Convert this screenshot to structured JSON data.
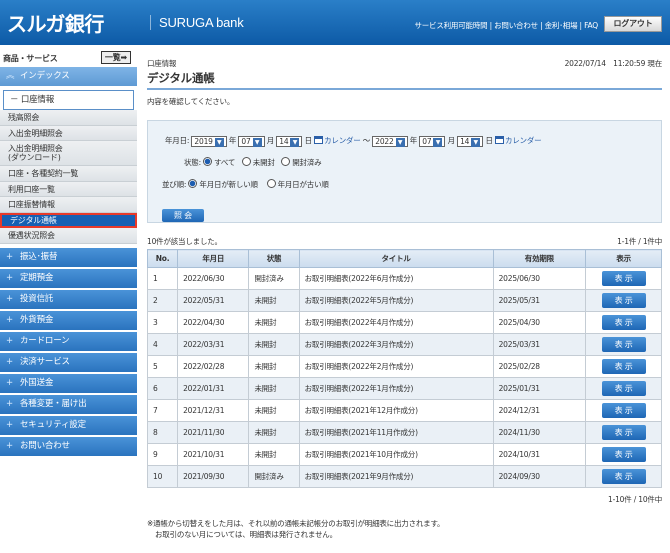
{
  "header": {
    "logo": "スルガ銀行",
    "logo_en": "SURUGA bank",
    "links": "サービス利用可能時間 | お問い合わせ | 金利･相場 | FAQ",
    "logout": "ログアウト"
  },
  "sidebar": {
    "title": "商品・サービス",
    "list_button": "一覧➡",
    "index": "インデックス",
    "account": "口座情報",
    "sub_items": [
      "残高照会",
      "入出金明細照会",
      "入出金明細照会\n(ダウンロード)",
      "口座・各種契約一覧",
      "利用口座一覧",
      "口座振替情報",
      "デジタル通帳",
      "優遇状況照会"
    ],
    "menu": [
      "振込･振替",
      "定期預金",
      "投資信託",
      "外貨預金",
      "カードローン",
      "決済サービス",
      "外国送金",
      "各種変更・届け出",
      "セキュリティ設定",
      "お問い合わせ"
    ]
  },
  "main": {
    "breadcrumb": "口座情報",
    "timestamp": "2022/07/14　11:20:59 現在",
    "title": "デジタル通帳",
    "instruction": "内容を確認してください。"
  },
  "search": {
    "date_label": "年月日:",
    "from_year": "2019",
    "from_month": "07",
    "from_day": "14",
    "to_year": "2022",
    "to_month": "07",
    "to_day": "14",
    "year_unit": "年",
    "month_unit": "月",
    "day_unit": "日",
    "calendar": "カレンダー",
    "tilde": "～",
    "status_label": "状態:",
    "status_all": "すべて",
    "status_unread": "未開封",
    "status_read": "開封済み",
    "sort_label": "並び順:",
    "sort_new": "年月日が新しい順",
    "sort_old": "年月日が古い順",
    "button": "照 会"
  },
  "results": {
    "count": "10件が該当しました。",
    "page_top": "1-1件 / 1件中",
    "page_bottom": "1-10件 / 10件中",
    "headers": [
      "No.",
      "年月日",
      "状態",
      "タイトル",
      "有効期限",
      "表示"
    ],
    "view_label": "表 示",
    "rows": [
      {
        "no": "1",
        "date": "2022/06/30",
        "status": "開封済み",
        "title": "お取引明細表(2022年6月作成分)",
        "expiry": "2025/06/30"
      },
      {
        "no": "2",
        "date": "2022/05/31",
        "status": "未開封",
        "title": "お取引明細表(2022年5月作成分)",
        "expiry": "2025/05/31"
      },
      {
        "no": "3",
        "date": "2022/04/30",
        "status": "未開封",
        "title": "お取引明細表(2022年4月作成分)",
        "expiry": "2025/04/30"
      },
      {
        "no": "4",
        "date": "2022/03/31",
        "status": "未開封",
        "title": "お取引明細表(2022年3月作成分)",
        "expiry": "2025/03/31"
      },
      {
        "no": "5",
        "date": "2022/02/28",
        "status": "未開封",
        "title": "お取引明細表(2022年2月作成分)",
        "expiry": "2025/02/28"
      },
      {
        "no": "6",
        "date": "2022/01/31",
        "status": "未開封",
        "title": "お取引明細表(2022年1月作成分)",
        "expiry": "2025/01/31"
      },
      {
        "no": "7",
        "date": "2021/12/31",
        "status": "未開封",
        "title": "お取引明細表(2021年12月作成分)",
        "expiry": "2024/12/31"
      },
      {
        "no": "8",
        "date": "2021/11/30",
        "status": "未開封",
        "title": "お取引明細表(2021年11月作成分)",
        "expiry": "2024/11/30"
      },
      {
        "no": "9",
        "date": "2021/10/31",
        "status": "未開封",
        "title": "お取引明細表(2021年10月作成分)",
        "expiry": "2024/10/31"
      },
      {
        "no": "10",
        "date": "2021/09/30",
        "status": "開封済み",
        "title": "お取引明細表(2021年9月作成分)",
        "expiry": "2024/09/30"
      }
    ]
  },
  "notes": [
    "※通帳から切替えをした月は、それ以前の通帳未記帳分のお取引が明細表に出力されます。",
    "お取引のない月については、明細表は発行されません。"
  ]
}
